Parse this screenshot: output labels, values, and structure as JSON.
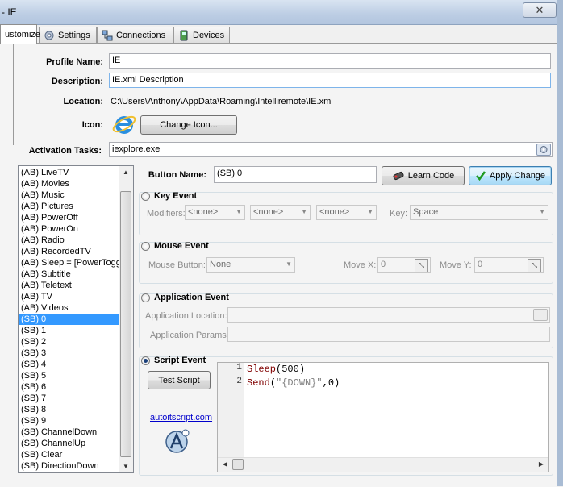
{
  "window": {
    "title": "- IE",
    "close_glyph": "✕"
  },
  "tabs": [
    {
      "label": "ustomize",
      "icon": ""
    },
    {
      "label": "Settings",
      "icon": "gear-icon"
    },
    {
      "label": "Connections",
      "icon": "network-icon"
    },
    {
      "label": "Devices",
      "icon": "device-icon"
    }
  ],
  "profile": {
    "name_label": "Profile Name:",
    "name_value": "IE",
    "description_label": "Description:",
    "description_value": "IE.xml Description",
    "location_label": "Location:",
    "location_value": "C:\\Users\\Anthony\\AppData\\Roaming\\Intelliremote\\IE.xml",
    "icon_label": "Icon:",
    "change_icon_button": "Change Icon...",
    "activation_label": "Activation Tasks:",
    "activation_value": "iexplore.exe"
  },
  "button_list": {
    "items": [
      "(AB) LiveTV",
      "(AB) Movies",
      "(AB) Music",
      "(AB) Pictures",
      "(AB) PowerOff",
      "(AB) PowerOn",
      "(AB) Radio",
      "(AB) RecordedTV",
      "(AB) Sleep = [PowerToggle]",
      "(AB) Subtitle",
      "(AB) Teletext",
      "(AB) TV",
      "(AB) Videos",
      "(SB) 0",
      "(SB) 1",
      "(SB) 2",
      "(SB) 3",
      "(SB) 4",
      "(SB) 5",
      "(SB) 6",
      "(SB) 7",
      "(SB) 8",
      "(SB) 9",
      "(SB) ChannelDown",
      "(SB) ChannelUp",
      "(SB) Clear",
      "(SB) DirectionDown"
    ],
    "selected": "(SB) 0",
    "scroll_up_glyph": "▲",
    "scroll_down_glyph": "▼"
  },
  "editor": {
    "button_name_label": "Button Name:",
    "button_name_value": "(SB) 0",
    "learn_code_button": "Learn Code",
    "apply_change_button": "Apply Change",
    "key_event": {
      "label": "Key Event",
      "modifiers_label": "Modifiers:",
      "modifier_values": [
        "<none>",
        "<none>",
        "<none>"
      ],
      "key_label": "Key:",
      "key_value": "Space"
    },
    "mouse_event": {
      "label": "Mouse Event",
      "button_label": "Mouse Button:",
      "button_value": "None",
      "move_x_label": "Move X:",
      "move_x_value": "0",
      "move_y_label": "Move Y:",
      "move_y_value": "0"
    },
    "application_event": {
      "label": "Application Event",
      "location_label": "Application Location:",
      "location_value": "",
      "params_label": "Application Params:",
      "params_value": ""
    },
    "script_event": {
      "label": "Script Event",
      "test_button": "Test Script",
      "link": "autoitscript.com",
      "line_numbers": [
        "1",
        "2"
      ],
      "code": [
        {
          "fn": "Sleep",
          "rest_open": "(500)",
          "str": "",
          "rest_close": ""
        },
        {
          "fn": "Send",
          "rest_open": "(",
          "str": "\"{DOWN}\"",
          "rest_close": ",0)"
        }
      ]
    }
  },
  "colors": {
    "selection": "#3399ff",
    "accent_border": "#3c7fb1",
    "keyword": "#800000",
    "string": "#808080"
  }
}
